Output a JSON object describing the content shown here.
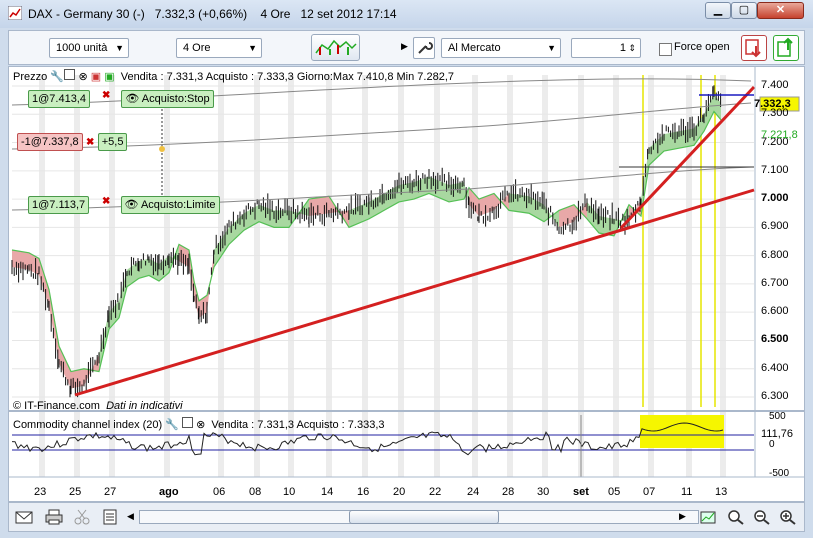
{
  "window": {
    "title": "DAX - Germany 30 (-)",
    "price": "7.332,3 (+0,66%)",
    "timeframe": "4 Ore",
    "datetime": "12 set 2012 17:14",
    "min_label": "▁",
    "max_label": "▢",
    "close_label": "✕"
  },
  "toolbar": {
    "quantity": "1000 unità",
    "timeframe": "4 Ore",
    "order_type": "Al Mercato",
    "order_qty": "1",
    "force_open_label": "Force open"
  },
  "price_pane": {
    "label": "Prezzo",
    "quote_info": "Vendita : 7.331,3 Acquisto : 7.333,3 Giorno:Max 7.410,8 Min 7.282,7",
    "orders": [
      {
        "value": "1@7.413,4",
        "type": "Acquisto:Stop"
      },
      {
        "value": "-1@7.337,8",
        "pnl": "+5,5"
      },
      {
        "value": "1@7.113,7",
        "type": "Acquisto:Limite"
      }
    ],
    "watermark": "© IT-Finance.com",
    "watermark_note": "Dati in indicativi",
    "y_ticks": [
      "7.400",
      "7.300",
      "7.200",
      "7.100",
      "7.000",
      "6.900",
      "6.800",
      "6.700",
      "6.600",
      "6.500",
      "6.400",
      "6.300"
    ],
    "y_bold_ticks": [
      "7.000",
      "6.500"
    ],
    "current_price": "7.332,3",
    "secondary_price": "7.221,8"
  },
  "cci_pane": {
    "label": "Commodity channel index (20)",
    "quote_info": "Vendita : 7.331,3 Acquisto : 7.333,3",
    "value": "111,76",
    "y_ticks": [
      "500",
      "0",
      "-500"
    ]
  },
  "x_axis": {
    "labels": [
      "23",
      "25",
      "27",
      "ago",
      "06",
      "08",
      "10",
      "14",
      "16",
      "20",
      "22",
      "24",
      "28",
      "30",
      "set",
      "05",
      "07",
      "11",
      "13"
    ]
  },
  "colors": {
    "bull_cloud": "#a8d8a0",
    "bear_cloud": "#e8a8a8",
    "trendline": "#d42020",
    "highlight": "#f6f600"
  }
}
